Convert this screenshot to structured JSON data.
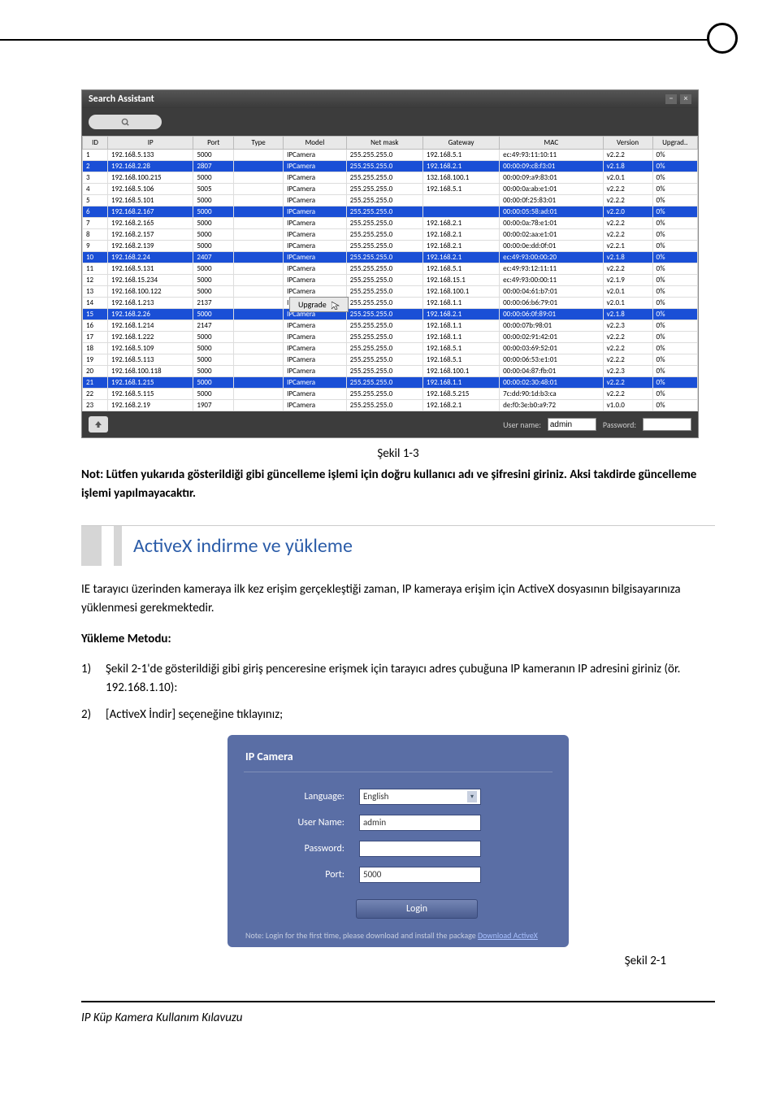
{
  "search_assistant": {
    "title": "Search Assistant",
    "headers": [
      "ID",
      "IP",
      "Port",
      "Type",
      "Model",
      "Net mask",
      "Gateway",
      "MAC",
      "Version",
      "Upgrad.."
    ],
    "context_menu": "Upgrade",
    "selected_rows": [
      1,
      5,
      9,
      14,
      20
    ],
    "rows": [
      {
        "id": "1",
        "ip": "192.168.5.133",
        "port": "5000",
        "type": "",
        "model": "IPCamera",
        "mask": "255.255.255.0",
        "gw": "192.168.5.1",
        "mac": "ec:49:93:11:10:11",
        "ver": "v2.2.2",
        "up": "0%"
      },
      {
        "id": "2",
        "ip": "192.168.2.28",
        "port": "2807",
        "type": "",
        "model": "IPCamera",
        "mask": "255.255.255.0",
        "gw": "192.168.2.1",
        "mac": "00:00:09:c8:f3:01",
        "ver": "v2.1.8",
        "up": "0%"
      },
      {
        "id": "3",
        "ip": "192.168.100.215",
        "port": "5000",
        "type": "",
        "model": "IPCamera",
        "mask": "255.255.255.0",
        "gw": "132.168.100.1",
        "mac": "00:00:09:a9:83:01",
        "ver": "v2.0.1",
        "up": "0%"
      },
      {
        "id": "4",
        "ip": "192.168.5.106",
        "port": "5005",
        "type": "",
        "model": "IPCamera",
        "mask": "255.255.255.0",
        "gw": "192.168.5.1",
        "mac": "00:00:0a:ab:e1:01",
        "ver": "v2.2.2",
        "up": "0%"
      },
      {
        "id": "5",
        "ip": "192.168.5.101",
        "port": "5000",
        "type": "",
        "model": "IPCamera",
        "mask": "255.255.255.0",
        "gw": "",
        "mac": "00:00:0f:25:83:01",
        "ver": "v2.2.2",
        "up": "0%"
      },
      {
        "id": "6",
        "ip": "192.168.2.167",
        "port": "5000",
        "type": "",
        "model": "IPCamera",
        "mask": "255.255.255.0",
        "gw": "",
        "mac": "00:00:05:58:ad:01",
        "ver": "v2.2.0",
        "up": "0%"
      },
      {
        "id": "7",
        "ip": "192.168.2.165",
        "port": "5000",
        "type": "",
        "model": "IPCamera",
        "mask": "255.255.255.0",
        "gw": "192.168.2.1",
        "mac": "00:00:0a:78:e1:01",
        "ver": "v2.2.2",
        "up": "0%"
      },
      {
        "id": "8",
        "ip": "192.168.2.157",
        "port": "5000",
        "type": "",
        "model": "IPCamera",
        "mask": "255.255.255.0",
        "gw": "192.168.2.1",
        "mac": "00:00:02:aa:e1:01",
        "ver": "v2.2.2",
        "up": "0%"
      },
      {
        "id": "9",
        "ip": "192.168.2.139",
        "port": "5000",
        "type": "",
        "model": "IPCamera",
        "mask": "255.255.255.0",
        "gw": "192.168.2.1",
        "mac": "00:00:0e:dd:0f:01",
        "ver": "v2.2.1",
        "up": "0%"
      },
      {
        "id": "10",
        "ip": "192.168.2.24",
        "port": "2407",
        "type": "",
        "model": "IPCamera",
        "mask": "255.255.255.0",
        "gw": "192.168.2.1",
        "mac": "ec:49:93:00:00:20",
        "ver": "v2.1.8",
        "up": "0%"
      },
      {
        "id": "11",
        "ip": "192.168.5.131",
        "port": "5000",
        "type": "",
        "model": "IPCamera",
        "mask": "255.255.255.0",
        "gw": "192.168.5.1",
        "mac": "ec:49:93:12:11:11",
        "ver": "v2.2.2",
        "up": "0%"
      },
      {
        "id": "12",
        "ip": "192.168.15.234",
        "port": "5000",
        "type": "",
        "model": "IPCamera",
        "mask": "255.255.255.0",
        "gw": "192.168.15.1",
        "mac": "ec:49:93:00:00:11",
        "ver": "v2.1.9",
        "up": "0%"
      },
      {
        "id": "13",
        "ip": "192.168.100.122",
        "port": "5000",
        "type": "",
        "model": "IPCamera",
        "mask": "255.255.255.0",
        "gw": "192.168.100.1",
        "mac": "00:00:04:61:b7:01",
        "ver": "v2.0.1",
        "up": "0%"
      },
      {
        "id": "14",
        "ip": "192.168.1.213",
        "port": "2137",
        "type": "",
        "model": "IPCamera",
        "mask": "255.255.255.0",
        "gw": "192.168.1.1",
        "mac": "00:00:06:b6:79:01",
        "ver": "v2.0.1",
        "up": "0%"
      },
      {
        "id": "15",
        "ip": "192.168.2.26",
        "port": "5000",
        "type": "",
        "model": "IPCamera",
        "mask": "255.255.255.0",
        "gw": "192.168.2.1",
        "mac": "00:00:06:0f:89:01",
        "ver": "v2.1.8",
        "up": "0%"
      },
      {
        "id": "16",
        "ip": "192.168.1.214",
        "port": "2147",
        "type": "",
        "model": "IPCamera",
        "mask": "255.255.255.0",
        "gw": "192.168.1.1",
        "mac": "00:00:07b:98:01",
        "ver": "v2.2.3",
        "up": "0%"
      },
      {
        "id": "17",
        "ip": "192.168.1.222",
        "port": "5000",
        "type": "",
        "model": "IPCamera",
        "mask": "255.255.255.0",
        "gw": "192.168.1.1",
        "mac": "00:00:02:91:42:01",
        "ver": "v2.2.2",
        "up": "0%"
      },
      {
        "id": "18",
        "ip": "192.168.5.109",
        "port": "5000",
        "type": "",
        "model": "IPCamera",
        "mask": "255.255.255.0",
        "gw": "192.168.5.1",
        "mac": "00:00:03:69:52:01",
        "ver": "v2.2.2",
        "up": "0%"
      },
      {
        "id": "19",
        "ip": "192.168.5.113",
        "port": "5000",
        "type": "",
        "model": "IPCamera",
        "mask": "255.255.255.0",
        "gw": "192.168.5.1",
        "mac": "00:00:06:53:e1:01",
        "ver": "v2.2.2",
        "up": "0%"
      },
      {
        "id": "20",
        "ip": "192.168.100.118",
        "port": "5000",
        "type": "",
        "model": "IPCamera",
        "mask": "255.255.255.0",
        "gw": "192.168.100.1",
        "mac": "00:00:04:87:fb:01",
        "ver": "v2.2.3",
        "up": "0%"
      },
      {
        "id": "21",
        "ip": "192.168.1.215",
        "port": "5000",
        "type": "",
        "model": "IPCamera",
        "mask": "255.255.255.0",
        "gw": "192.168.1.1",
        "mac": "00:00:02:30:48:01",
        "ver": "v2.2.2",
        "up": "0%"
      },
      {
        "id": "22",
        "ip": "192.168.5.115",
        "port": "5000",
        "type": "",
        "model": "IPCamera",
        "mask": "255.255.255.0",
        "gw": "192.168.5.215",
        "mac": "7c:dd:90:1d:b3:ca",
        "ver": "v2.2.2",
        "up": "0%"
      },
      {
        "id": "23",
        "ip": "192.168.2.19",
        "port": "1907",
        "type": "",
        "model": "IPCamera",
        "mask": "255.255.255.0",
        "gw": "192.168.2.1",
        "mac": "de:f0:3e:b0:a9:72",
        "ver": "v1.0.0",
        "up": "0%"
      }
    ],
    "footer": {
      "username_label": "User name:",
      "username_value": "admin",
      "password_label": "Password:"
    }
  },
  "doc": {
    "fig1_caption": "Şekil 1-3",
    "note_text": "Not: Lütfen yukarıda gösterildiği gibi güncelleme işlemi için doğru kullanıcı adı ve şifresini giriniz. Aksi takdirde güncelleme işlemi yapılmayacaktır.",
    "section_title": "ActiveX indirme ve yükleme",
    "para1": "IE tarayıcı üzerinden kameraya ilk kez erişim gerçekleştiği zaman, IP kameraya erişim için ActiveX dosyasının bilgisayarınıza yüklenmesi gerekmektedir.",
    "method_label": "Yükleme Metodu:",
    "step1_num": "1)",
    "step1_text": "Şekil 2-1'de gösterildiği gibi giriş penceresine erişmek için tarayıcı adres çubuğuna IP kameranın IP adresini giriniz (ör. 192.168.1.10):",
    "step2_num": "2)",
    "step2_text": "[ActiveX İndir] seçeneğine tıklayınız;",
    "fig2_caption": "Şekil 2-1",
    "footer_text": "IP Küp Kamera Kullanım Kılavuzu"
  },
  "login": {
    "title": "IP Camera",
    "language_label": "Language:",
    "language_value": "English",
    "username_label": "User Name:",
    "username_value": "admin",
    "password_label": "Password:",
    "port_label": "Port:",
    "port_value": "5000",
    "login_button": "Login",
    "note_prefix": "Note: Login for the first time, please download and install the package ",
    "note_link": "Download ActiveX"
  }
}
